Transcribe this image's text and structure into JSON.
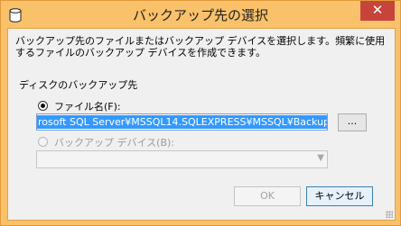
{
  "window": {
    "title": "バックアップ先の選択",
    "close_glyph": "✕",
    "app_icon": "database-icon"
  },
  "description": "バックアップ先のファイルまたはバックアップ デバイスを選択します。頻繁に使用するファイルのバックアップ デバイスを作成できます。",
  "group": {
    "label": "ディスクのバックアップ先"
  },
  "options": {
    "filename_label": "ファイル名(F):",
    "filename_selected": true,
    "device_label": "バックアップ デバイス(B):",
    "device_enabled": false
  },
  "path": {
    "value": "rosoft SQL Server¥MSSQL14.SQLEXPRESS¥MSSQL¥Backup¥"
  },
  "buttons": {
    "browse": "...",
    "ok": "OK",
    "cancel": "キャンセル"
  },
  "colors": {
    "title_bar": "#f9c16a",
    "close_button": "#c7443b",
    "selection": "#3399ff"
  }
}
